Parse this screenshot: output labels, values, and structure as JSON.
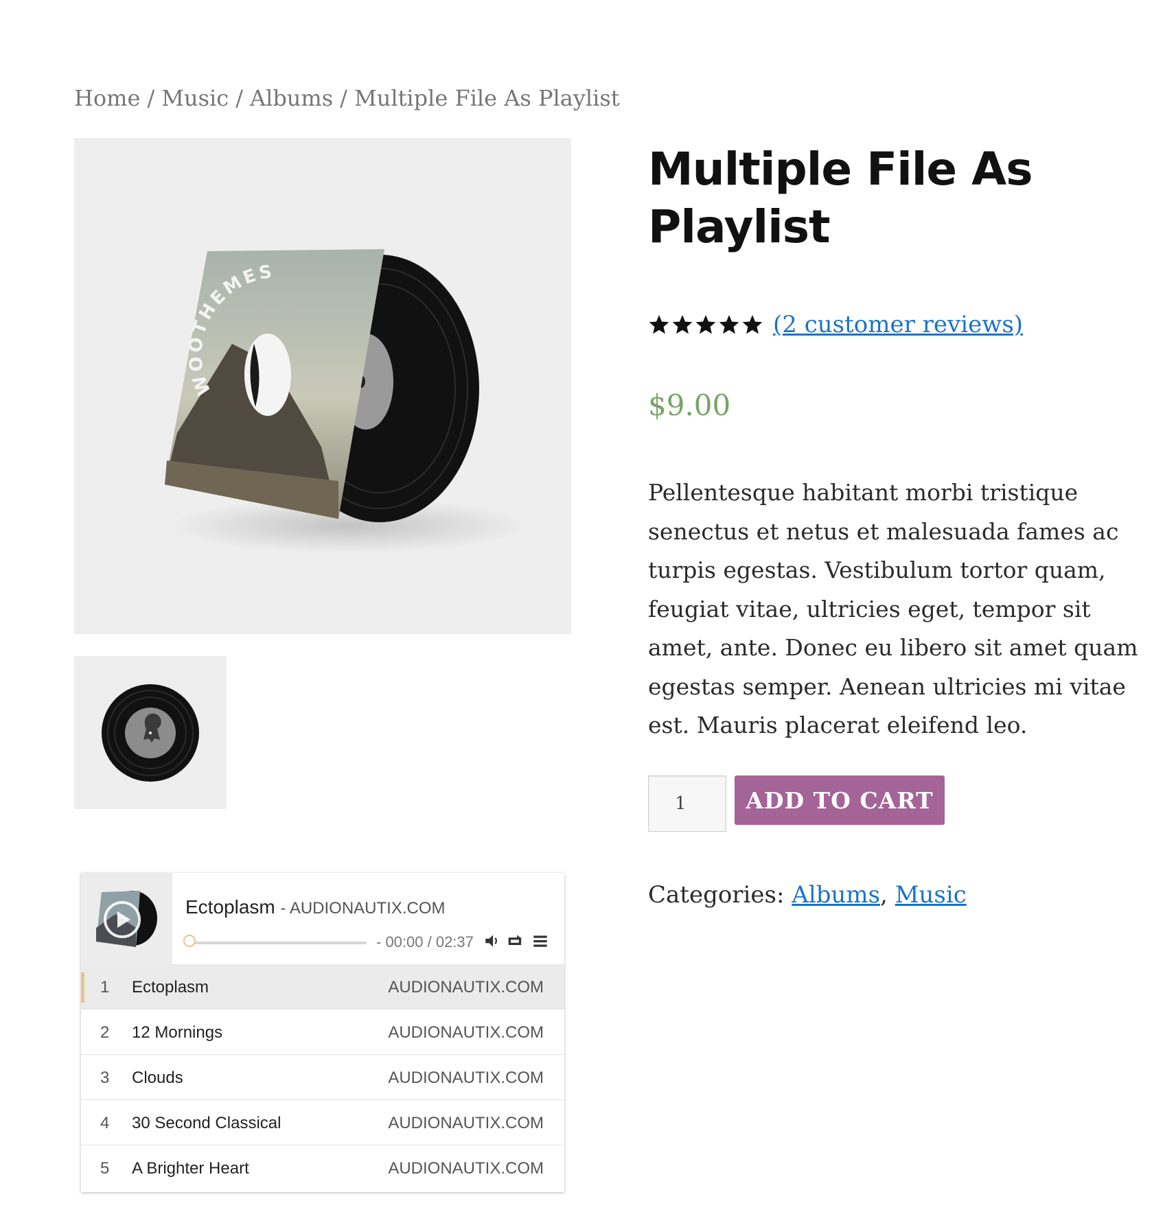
{
  "breadcrumb": {
    "items": [
      "Home",
      "Music",
      "Albums",
      "Multiple File As Playlist"
    ],
    "separator": "/"
  },
  "product": {
    "title": "Multiple File As Playlist",
    "rating": {
      "stars": 5,
      "max": 5,
      "reviews_link": "(2 customer reviews)"
    },
    "price": "$9.00",
    "description": "Pellentesque habitant morbi tristique senectus et netus et malesuada fames ac turpis egestas. Vestibulum tortor quam, feugiat vitae, ultricies eget, tempor sit amet, ante. Donec eu libero sit amet quam egestas semper. Aenean ultricies mi vitae est. Mauris placerat eleifend leo.",
    "quantity": "1",
    "add_to_cart_label": "ADD TO CART",
    "categories_label": "Categories:",
    "categories": [
      "Albums",
      "Music"
    ],
    "category_separator": ","
  },
  "gallery": {
    "album_text": "WOOTHEMES"
  },
  "player": {
    "now_playing_title": "Ectoplasm",
    "now_playing_artist": "- AUDIONAUTIX.COM",
    "time": "- 00:00 / 02:37",
    "progress": 0,
    "icons": [
      "play-icon",
      "volume-icon",
      "repeat-icon",
      "playlist-menu-icon"
    ],
    "tracks": [
      {
        "num": "1",
        "title": "Ectoplasm",
        "artist": "AUDIONAUTIX.COM"
      },
      {
        "num": "2",
        "title": "12 Mornings",
        "artist": "AUDIONAUTIX.COM"
      },
      {
        "num": "3",
        "title": "Clouds",
        "artist": "AUDIONAUTIX.COM"
      },
      {
        "num": "4",
        "title": "30 Second Classical",
        "artist": "AUDIONAUTIX.COM"
      },
      {
        "num": "5",
        "title": "A Brighter Heart",
        "artist": "AUDIONAUTIX.COM"
      }
    ],
    "active_track": 0
  },
  "colors": {
    "price": "#77a464",
    "button": "#a46497",
    "link": "#1a73c8",
    "accent": "#e4c58f"
  }
}
